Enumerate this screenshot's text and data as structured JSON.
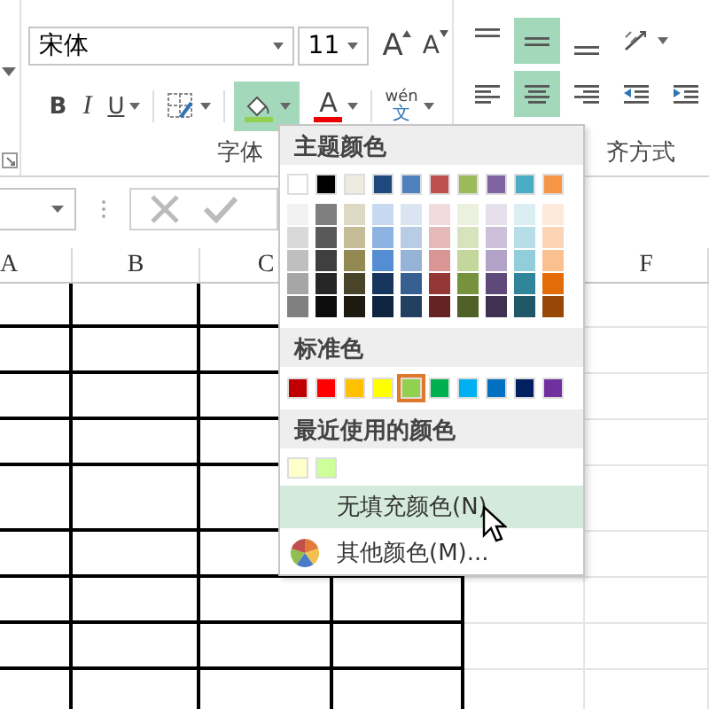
{
  "ribbon": {
    "font_group": {
      "font_name": "宋体",
      "font_size": "11",
      "grow_label": "A",
      "shrink_label": "A",
      "bold_label": "B",
      "italic_label": "I",
      "underline_label": "U",
      "fill_button": {
        "selected": true
      },
      "font_color_label": "A",
      "phonetic_top": "wén",
      "phonetic_bottom": "文",
      "label": "字体"
    },
    "alignment_group": {
      "label": "齐方式",
      "rows": [
        [
          {
            "kind": "align-top",
            "selected": false
          },
          {
            "kind": "align-middle",
            "selected": true
          },
          {
            "kind": "align-bottom",
            "selected": false
          },
          {
            "kind": "orientation",
            "selected": false
          }
        ],
        [
          {
            "kind": "align-left",
            "selected": false
          },
          {
            "kind": "align-center",
            "selected": true
          },
          {
            "kind": "align-right",
            "selected": false
          },
          {
            "kind": "indent-decrease",
            "selected": false
          },
          {
            "kind": "indent-increase",
            "selected": false
          }
        ]
      ]
    }
  },
  "sheet": {
    "columns": [
      {
        "label": "A"
      },
      {
        "label": "B"
      },
      {
        "label": "C"
      },
      {
        "label": "F"
      }
    ]
  },
  "color_menu": {
    "theme_title": "主题颜色",
    "theme_colors": [
      {
        "color": "#ffffff",
        "shades": [
          {
            "color": "#f2f2f2"
          },
          {
            "color": "#d9d9d9"
          },
          {
            "color": "#bfbfbf"
          },
          {
            "color": "#a6a6a6"
          },
          {
            "color": "#808080"
          }
        ]
      },
      {
        "color": "#000000",
        "shades": [
          {
            "color": "#7f7f7f"
          },
          {
            "color": "#595959"
          },
          {
            "color": "#3f3f3f"
          },
          {
            "color": "#262626"
          },
          {
            "color": "#0c0c0c"
          }
        ]
      },
      {
        "color": "#eeece1",
        "shades": [
          {
            "color": "#ddd9c3"
          },
          {
            "color": "#c4bd97"
          },
          {
            "color": "#938953"
          },
          {
            "color": "#494429"
          },
          {
            "color": "#1d1b10"
          }
        ]
      },
      {
        "color": "#1f497d",
        "shades": [
          {
            "color": "#c6d9f0"
          },
          {
            "color": "#8db3e2"
          },
          {
            "color": "#548dd4"
          },
          {
            "color": "#17365d"
          },
          {
            "color": "#0f243e"
          }
        ]
      },
      {
        "color": "#4f81bd",
        "shades": [
          {
            "color": "#dbe5f1"
          },
          {
            "color": "#b8cce4"
          },
          {
            "color": "#95b3d7"
          },
          {
            "color": "#366092"
          },
          {
            "color": "#244061"
          }
        ]
      },
      {
        "color": "#c0504d",
        "shades": [
          {
            "color": "#f2dcdb"
          },
          {
            "color": "#e5b9b7"
          },
          {
            "color": "#d99694"
          },
          {
            "color": "#953734"
          },
          {
            "color": "#632423"
          }
        ]
      },
      {
        "color": "#9bbb59",
        "shades": [
          {
            "color": "#ebf1dd"
          },
          {
            "color": "#d7e3bc"
          },
          {
            "color": "#c3d69b"
          },
          {
            "color": "#76923c"
          },
          {
            "color": "#4f6128"
          }
        ]
      },
      {
        "color": "#8064a2",
        "shades": [
          {
            "color": "#e5e0ec"
          },
          {
            "color": "#ccc1d9"
          },
          {
            "color": "#b2a2c7"
          },
          {
            "color": "#5f497a"
          },
          {
            "color": "#3f3151"
          }
        ]
      },
      {
        "color": "#4bacc6",
        "shades": [
          {
            "color": "#dbeef3"
          },
          {
            "color": "#b7dde8"
          },
          {
            "color": "#92cddc"
          },
          {
            "color": "#31859b"
          },
          {
            "color": "#205867"
          }
        ]
      },
      {
        "color": "#f79646",
        "shades": [
          {
            "color": "#fdeada"
          },
          {
            "color": "#fbd5b5"
          },
          {
            "color": "#fac08f"
          },
          {
            "color": "#e36c09"
          },
          {
            "color": "#974806"
          }
        ]
      }
    ],
    "standard_title": "标准色",
    "standard_colors": [
      {
        "color": "#c00000",
        "selected": false
      },
      {
        "color": "#ff0000",
        "selected": false
      },
      {
        "color": "#ffc000",
        "selected": false
      },
      {
        "color": "#ffff00",
        "selected": false
      },
      {
        "color": "#92d050",
        "selected": true
      },
      {
        "color": "#00b050",
        "selected": false
      },
      {
        "color": "#00b0f0",
        "selected": false
      },
      {
        "color": "#0070c0",
        "selected": false
      },
      {
        "color": "#002060",
        "selected": false
      },
      {
        "color": "#7030a0",
        "selected": false
      }
    ],
    "recent_title": "最近使用的颜色",
    "recent_colors": [
      {
        "color": "#ffffcc"
      },
      {
        "color": "#ccff99"
      }
    ],
    "items": [
      {
        "kind": "no-fill",
        "label": "无填充颜色(N)",
        "selected": true
      },
      {
        "kind": "more-colors",
        "label": "其他颜色(M)...",
        "selected": false
      }
    ]
  }
}
